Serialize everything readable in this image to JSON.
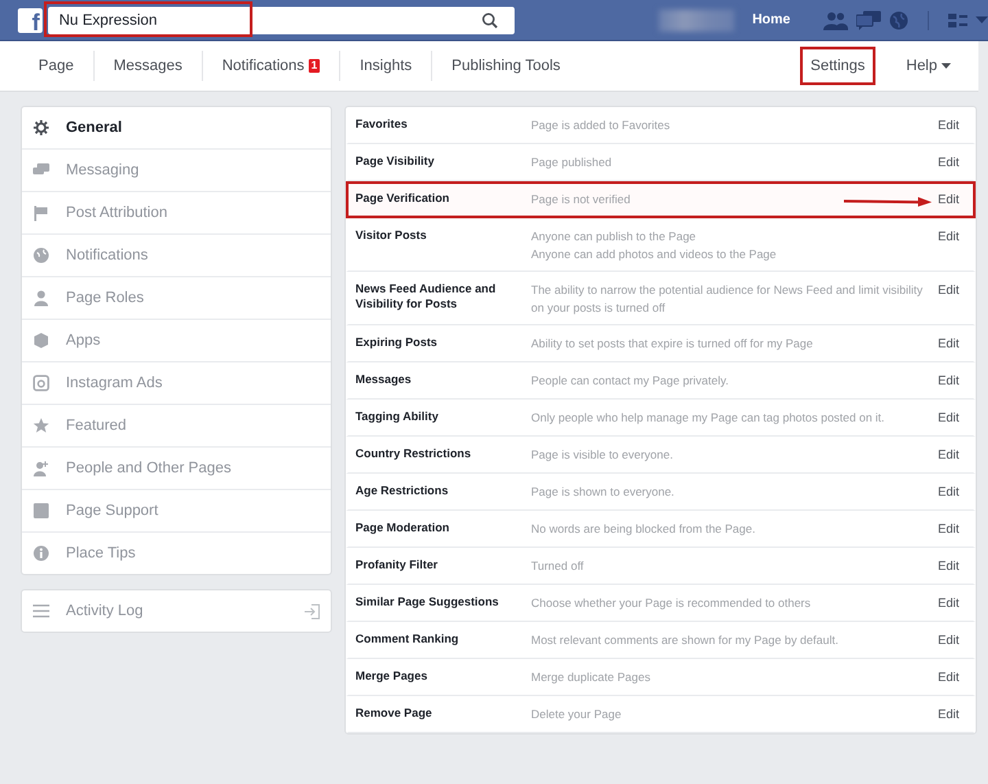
{
  "topbar": {
    "logo": "f",
    "search": {
      "value": "Nu Expression",
      "highlighted": true
    },
    "home": "Home"
  },
  "nav": {
    "left": [
      {
        "label": "Page"
      },
      {
        "label": "Messages"
      },
      {
        "label": "Notifications",
        "badge": "1"
      },
      {
        "label": "Insights"
      },
      {
        "label": "Publishing Tools"
      }
    ],
    "right": [
      {
        "label": "Settings",
        "highlighted": true,
        "caret": false
      },
      {
        "label": "Help",
        "highlighted": false,
        "caret": true
      }
    ]
  },
  "sidebar": {
    "items": [
      {
        "label": "General",
        "selected": true
      },
      {
        "label": "Messaging",
        "selected": false
      },
      {
        "label": "Post Attribution",
        "selected": false
      },
      {
        "label": "Notifications",
        "selected": false
      },
      {
        "label": "Page Roles",
        "selected": false
      },
      {
        "label": "Apps",
        "selected": false
      },
      {
        "label": "Instagram Ads",
        "selected": false
      },
      {
        "label": "Featured",
        "selected": false
      },
      {
        "label": "People and Other Pages",
        "selected": false
      },
      {
        "label": "Page Support",
        "selected": false
      },
      {
        "label": "Place Tips",
        "selected": false
      }
    ],
    "activity_log": "Activity Log"
  },
  "settings": [
    {
      "name": "Favorites",
      "value": [
        "Page is added to Favorites"
      ],
      "action": "Edit",
      "highlighted": false
    },
    {
      "name": "Page Visibility",
      "value": [
        "Page published"
      ],
      "action": "Edit",
      "highlighted": false
    },
    {
      "name": "Page Verification",
      "value": [
        "Page is not verified"
      ],
      "action": "Edit",
      "highlighted": true
    },
    {
      "name": "Visitor Posts",
      "value": [
        "Anyone can publish to the Page",
        "Anyone can add photos and videos to the Page"
      ],
      "action": "Edit",
      "highlighted": false
    },
    {
      "name": "News Feed Audience and Visibility for Posts",
      "value": [
        "The ability to narrow the potential audience for News Feed and limit visibility on your posts is turned off"
      ],
      "action": "Edit",
      "highlighted": false
    },
    {
      "name": "Expiring Posts",
      "value": [
        "Ability to set posts that expire is turned off for my Page"
      ],
      "action": "Edit",
      "highlighted": false
    },
    {
      "name": "Messages",
      "value": [
        "People can contact my Page privately."
      ],
      "action": "Edit",
      "highlighted": false
    },
    {
      "name": "Tagging Ability",
      "value": [
        "Only people who help manage my Page can tag photos posted on it."
      ],
      "action": "Edit",
      "highlighted": false
    },
    {
      "name": "Country Restrictions",
      "value": [
        "Page is visible to everyone."
      ],
      "action": "Edit",
      "highlighted": false
    },
    {
      "name": "Age Restrictions",
      "value": [
        "Page is shown to everyone."
      ],
      "action": "Edit",
      "highlighted": false
    },
    {
      "name": "Page Moderation",
      "value": [
        "No words are being blocked from the Page."
      ],
      "action": "Edit",
      "highlighted": false
    },
    {
      "name": "Profanity Filter",
      "value": [
        "Turned off"
      ],
      "action": "Edit",
      "highlighted": false
    },
    {
      "name": "Similar Page Suggestions",
      "value": [
        "Choose whether your Page is recommended to others"
      ],
      "action": "Edit",
      "highlighted": false
    },
    {
      "name": "Comment Ranking",
      "value": [
        "Most relevant comments are shown for my Page by default."
      ],
      "action": "Edit",
      "highlighted": false
    },
    {
      "name": "Merge Pages",
      "value": [
        "Merge duplicate Pages"
      ],
      "action": "Edit",
      "highlighted": false
    },
    {
      "name": "Remove Page",
      "value": [
        "Delete your Page"
      ],
      "action": "Edit",
      "highlighted": false
    }
  ]
}
